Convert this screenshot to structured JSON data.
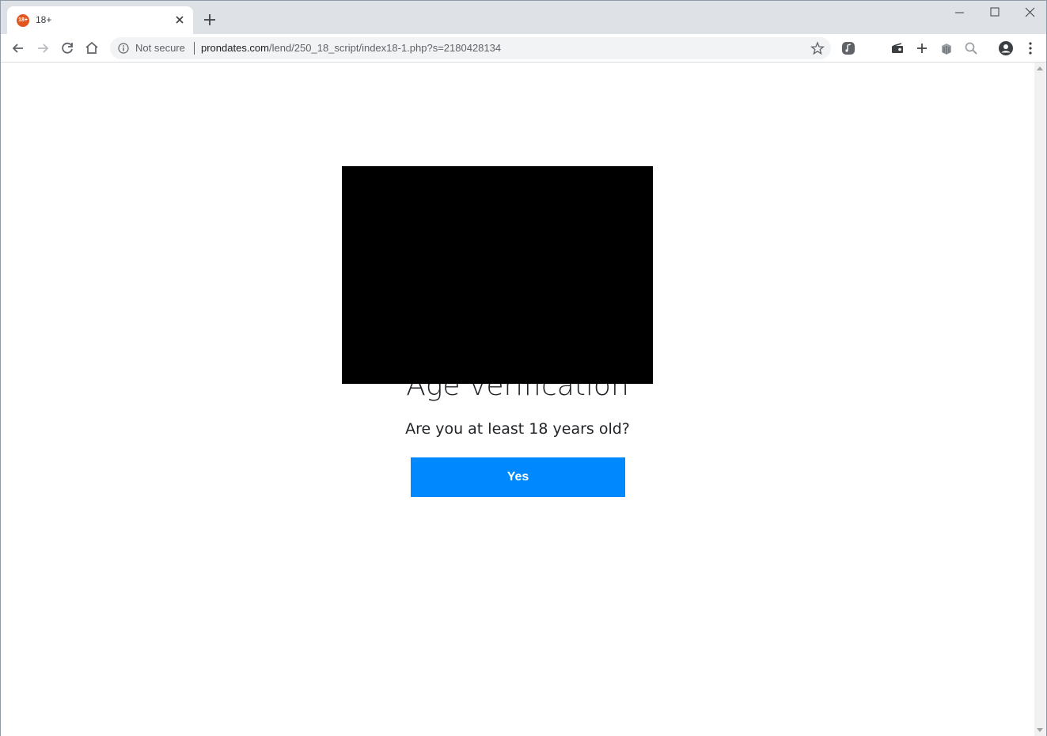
{
  "browser": {
    "tab": {
      "title": "18+",
      "favicon_text": "18+"
    },
    "omnibox": {
      "security_label": "Not secure",
      "url_host": "prondates.com",
      "url_path": "/lend/250_18_script/index18-1.php?s=2180428134"
    },
    "icons": [
      "back-icon",
      "forward-icon",
      "reload-icon",
      "home-icon",
      "info-icon",
      "star-icon",
      "extension-icon",
      "cast-icon",
      "plus-icon",
      "stack-icon",
      "zoom-icon",
      "profile-icon",
      "menu-icon"
    ]
  },
  "page": {
    "heading": "Age verification",
    "question": "Are you at least 18 years old?",
    "yes_label": "Yes",
    "button_color": "#0088ff"
  }
}
